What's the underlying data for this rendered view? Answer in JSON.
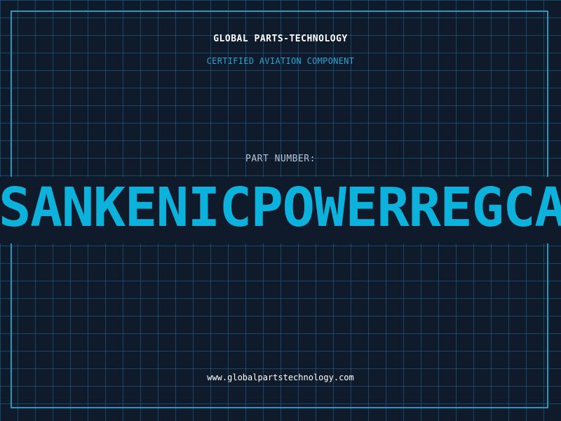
{
  "header": {
    "company": "GLOBAL PARTS-TECHNOLOGY",
    "subtitle": "CERTIFIED AVIATION COMPONENT"
  },
  "part": {
    "label": "PART NUMBER:",
    "number": "SANKENICPOWERREGCAT"
  },
  "footer": {
    "website": "www.globalpartstechnology.com"
  },
  "colors": {
    "background": "#0f1a2b",
    "grid": "#1c6e96",
    "frame": "#1e9cc4",
    "accent": "#0db2dc",
    "subtitle": "#2aa4d4",
    "label": "#b6c3d2"
  }
}
